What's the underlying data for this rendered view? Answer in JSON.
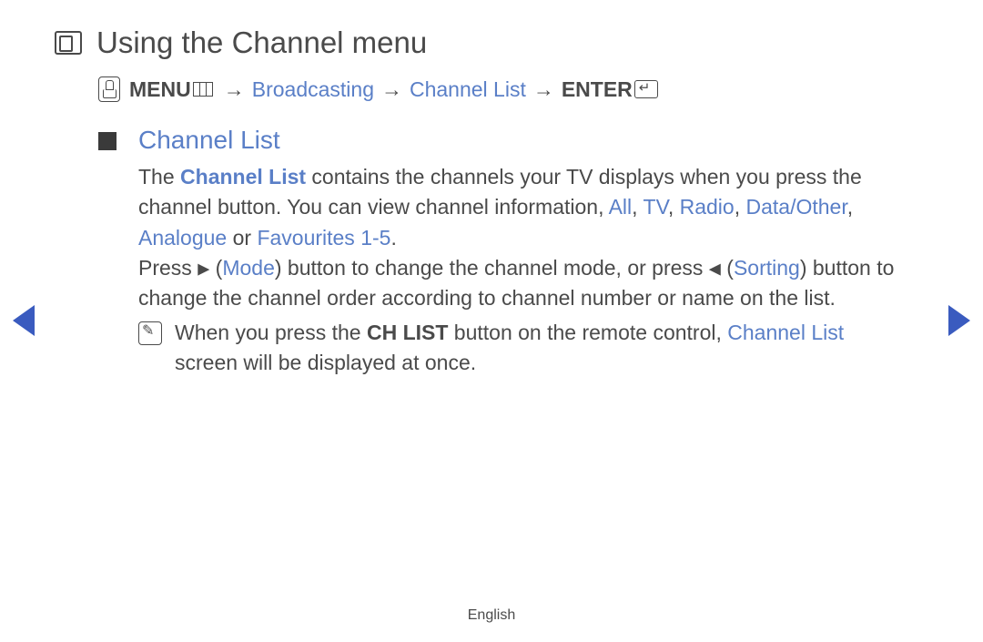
{
  "title": "Using the Channel menu",
  "breadcrumb": {
    "menu_label": "MENU",
    "sep": "→",
    "item1": "Broadcasting",
    "item2": "Channel List",
    "enter_label": "ENTER"
  },
  "section_title": "Channel List",
  "para1": {
    "t1": "The ",
    "term1": "Channel List",
    "t2": " contains the channels your TV displays when you press the channel button. You can view channel information, ",
    "all": "All",
    "c1": ", ",
    "tv": "TV",
    "c2": ", ",
    "radio": "Radio",
    "c3": ", ",
    "data_other": "Data/Other",
    "c4": ", ",
    "analogue": "Analogue",
    "or": " or ",
    "fav": "Favourites 1-5",
    "dot": "."
  },
  "para2": {
    "t1": "Press ",
    "tri_r": "▶",
    "open1": " (",
    "mode": "Mode",
    "t2": ") button to change the channel mode, or press ",
    "tri_l": "◀",
    "open2": " (",
    "sorting": "Sorting",
    "t3": ") button to change the channel order according to channel number or name on the list."
  },
  "note": {
    "t1": "When you press the ",
    "chlist": "CH LIST",
    "t2": " button on the remote control, ",
    "cl": "Channel List",
    "t3": " screen will be displayed at once."
  },
  "footer": "English"
}
